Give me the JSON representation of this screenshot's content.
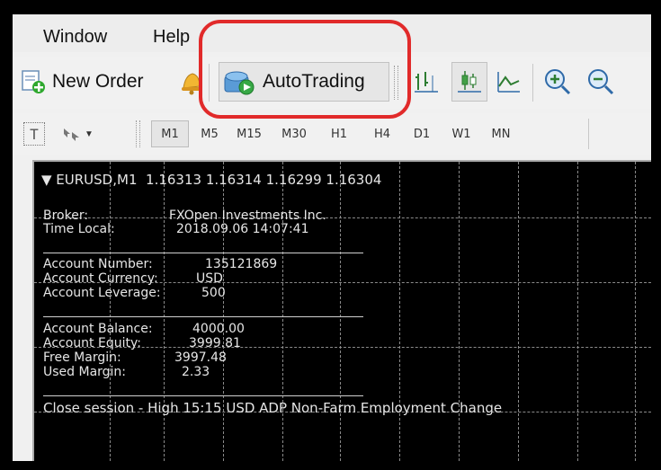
{
  "menu": {
    "items": [
      "Window",
      "Help"
    ]
  },
  "toolbar": {
    "new_order_label": "New Order",
    "autotrading_label": "AutoTrading",
    "icons": [
      "new-order-icon",
      "bell-icon",
      "autotrading-icon",
      "bar-chart-icon",
      "candlestick-icon",
      "line-chart-icon",
      "zoom-in-icon",
      "zoom-out-icon"
    ]
  },
  "timeframes": [
    {
      "label": "M1",
      "active": true
    },
    {
      "label": "M5",
      "active": false
    },
    {
      "label": "M15",
      "active": false
    },
    {
      "label": "M30",
      "active": false
    },
    {
      "label": "H1",
      "active": false
    },
    {
      "label": "H4",
      "active": false
    },
    {
      "label": "D1",
      "active": false
    },
    {
      "label": "W1",
      "active": false
    },
    {
      "label": "MN",
      "active": false
    }
  ],
  "chart": {
    "header": "▼ EURUSD,M1  1.16313 1.16314 1.16299 1.16304",
    "broker_label": "Broker:",
    "broker_value": "FXOpen Investments Inc.",
    "time_label": "Time Local:",
    "time_value": "2018.09.06 14:07:41",
    "acc_number_label": "Account Number:",
    "acc_number_value": "135121869",
    "acc_currency_label": "Account Currency:",
    "acc_currency_value": "USD",
    "acc_leverage_label": "Account Leverage:",
    "acc_leverage_value": "500",
    "balance_label": "Account Balance:",
    "balance_value": "4000.00",
    "equity_label": "Account Equity:",
    "equity_value": "3999.81",
    "free_margin_label": "Free Margin:",
    "free_margin_value": "3997.48",
    "used_margin_label": "Used Margin:",
    "used_margin_value": "2.33",
    "news": "Close session - High 15:15 USD ADP Non-Farm Employment Change"
  },
  "colors": {
    "highlight": "#e12a2a",
    "chart_bg": "#000000",
    "chart_text": "#e6e6e6"
  }
}
